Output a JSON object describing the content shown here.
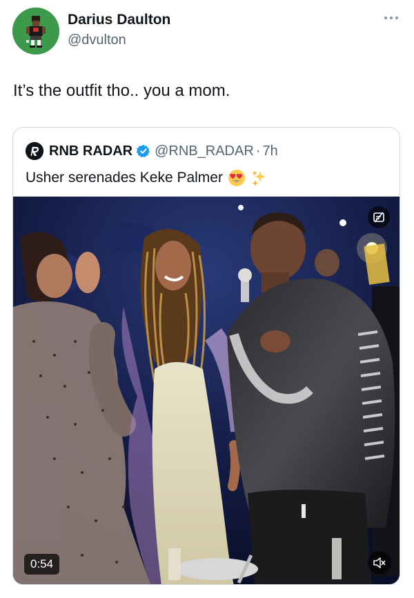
{
  "tweet": {
    "author": {
      "display_name": "Darius Daulton",
      "handle": "@dvulton"
    },
    "more_icon": "more-horizontal-icon",
    "text": "It’s the outfit tho.. you a mom."
  },
  "quote": {
    "author": {
      "display_name": "RNB RADAR",
      "handle": "@RNB_RADAR",
      "verified": true
    },
    "separator": "·",
    "time": "7h",
    "text": "Usher serenades Keke Palmer",
    "emojis": [
      "heart-eyes-emoji",
      "sparkles-emoji"
    ],
    "video": {
      "duration": "0:54",
      "mute_icon": "muted-speaker-icon",
      "corner_icon": "content-warning-icon"
    }
  },
  "colors": {
    "avatar_bg": "#3d9a4c",
    "verified": "#1d9bf0",
    "secondary_text": "#536471",
    "border": "#cfd9de"
  }
}
